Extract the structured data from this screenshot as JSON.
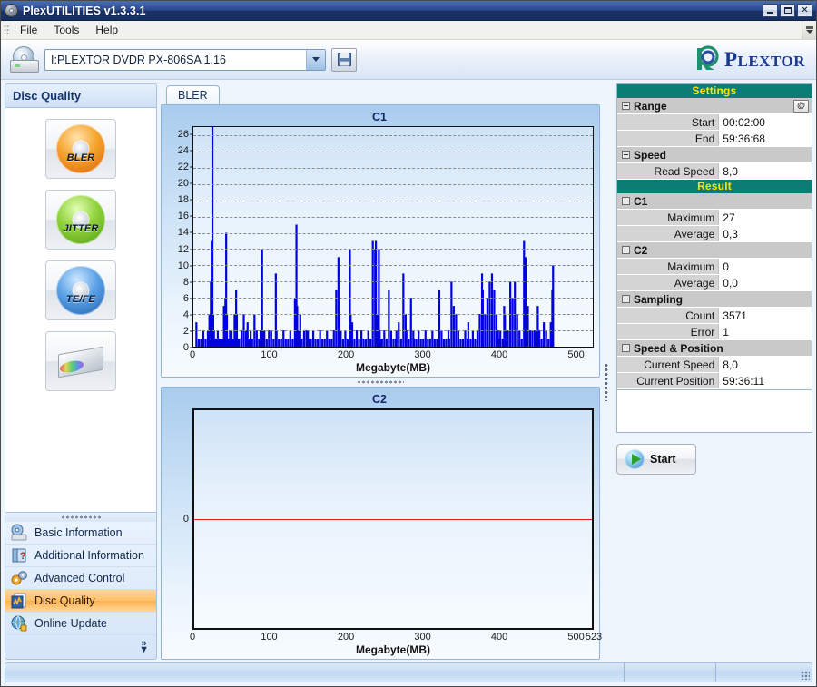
{
  "window": {
    "title": "PlexUTILITIES v1.3.3.1",
    "icon": "disc-icon",
    "minimize_label": "_",
    "maximize_label": "□",
    "close_label": "✕"
  },
  "menu": {
    "items": [
      "File",
      "Tools",
      "Help"
    ],
    "overflow_icon": "menu-overflow-icon"
  },
  "toolbar": {
    "drive_icon": "optical-drive-icon",
    "drive_value": "I:PLEXTOR DVDR  PX-806SA  1.16",
    "drive_placeholder": "Select drive",
    "dropdown_icon": "chevron-down-icon",
    "save_icon": "floppy-save-icon",
    "brand": "PLEXTOR",
    "brand_lead": "P",
    "brand_rest": "LEXTOR"
  },
  "sidebar": {
    "header": "Disc Quality",
    "task_buttons": [
      {
        "label": "BLER",
        "icon": "orange-disc-icon"
      },
      {
        "label": "JITTER",
        "icon": "green-disc-icon"
      },
      {
        "label": "TE/FE",
        "icon": "blue-disc-icon"
      },
      {
        "label": "",
        "icon": "drive-tray-icon"
      }
    ],
    "nav_items": [
      {
        "label": "Basic Information",
        "icon": "drive-info-icon",
        "active": false
      },
      {
        "label": "Additional Information",
        "icon": "book-question-icon",
        "active": false
      },
      {
        "label": "Advanced Control",
        "icon": "gears-icon",
        "active": false
      },
      {
        "label": "Disc Quality",
        "icon": "chart-page-icon",
        "active": true
      },
      {
        "label": "Online Update",
        "icon": "globe-update-icon",
        "active": false
      }
    ],
    "expand_icon": "chevrons-down-icon"
  },
  "tabs": [
    {
      "label": "BLER",
      "active": true
    }
  ],
  "chart_data": [
    {
      "type": "bar",
      "title": "C1",
      "xlabel": "Megabyte(MB)",
      "ylabel": "",
      "xticks": [
        0,
        100,
        200,
        300,
        400,
        500
      ],
      "yticks": [
        0,
        2,
        4,
        6,
        8,
        10,
        12,
        14,
        16,
        18,
        20,
        22,
        24,
        26
      ],
      "xlim": [
        0,
        523
      ],
      "ylim": [
        0,
        27
      ],
      "grid": true,
      "series_color": "#0000e0",
      "x": [
        4,
        7,
        10,
        13,
        16,
        19,
        21,
        22,
        23,
        24,
        25,
        26,
        27,
        28,
        30,
        32,
        34,
        36,
        38,
        40,
        42,
        43,
        44,
        46,
        48,
        50,
        52,
        54,
        56,
        57,
        58,
        60,
        63,
        66,
        69,
        71,
        73,
        75,
        77,
        80,
        83,
        86,
        88,
        90,
        91,
        93,
        96,
        99,
        102,
        105,
        108,
        109,
        112,
        115,
        118,
        121,
        124,
        127,
        130,
        133,
        135,
        136,
        138,
        140,
        142,
        145,
        148,
        150,
        151,
        154,
        157,
        160,
        163,
        166,
        169,
        172,
        175,
        178,
        181,
        184,
        187,
        190,
        191,
        193,
        196,
        199,
        202,
        205,
        206,
        208,
        211,
        214,
        217,
        220,
        223,
        226,
        229,
        232,
        235,
        238,
        239,
        241,
        243,
        244,
        245,
        247,
        250,
        253,
        256,
        259,
        262,
        265,
        266,
        269,
        272,
        275,
        278,
        279,
        282,
        285,
        288,
        289,
        292,
        295,
        298,
        301,
        304,
        307,
        310,
        313,
        316,
        319,
        322,
        325,
        328,
        331,
        334,
        335,
        338,
        341,
        344,
        347,
        350,
        353,
        356,
        359,
        360,
        363,
        366,
        369,
        372,
        375,
        378,
        379,
        382,
        385,
        388,
        391,
        394,
        397,
        399,
        400,
        402,
        405,
        407,
        408,
        409,
        410,
        412,
        415,
        418,
        421,
        424,
        427,
        430,
        433,
        435,
        438,
        441,
        444,
        447,
        450,
        451,
        453,
        456,
        459,
        462,
        465,
        468,
        470,
        471,
        473,
        476,
        479,
        482,
        485,
        488,
        490,
        493,
        496,
        499,
        502,
        505,
        508,
        511,
        514,
        516,
        518,
        520
      ],
      "y": [
        3,
        1,
        1,
        2,
        1,
        2,
        4,
        1,
        8,
        13,
        27,
        4,
        2,
        1,
        1,
        2,
        1,
        1,
        1,
        5,
        6,
        14,
        4,
        1,
        2,
        2,
        1,
        4,
        7,
        4,
        1,
        1,
        2,
        4,
        2,
        3,
        1,
        2,
        1,
        4,
        2,
        1,
        2,
        12,
        2,
        2,
        1,
        2,
        2,
        1,
        9,
        2,
        1,
        1,
        2,
        1,
        1,
        2,
        1,
        6,
        15,
        5,
        2,
        4,
        1,
        2,
        2,
        2,
        1,
        1,
        2,
        1,
        1,
        2,
        1,
        1,
        2,
        1,
        1,
        2,
        7,
        11,
        4,
        2,
        1,
        2,
        1,
        12,
        4,
        3,
        1,
        2,
        1,
        2,
        1,
        1,
        2,
        1,
        13,
        12,
        13,
        4,
        12,
        2,
        1,
        1,
        2,
        1,
        7,
        2,
        1,
        1,
        2,
        3,
        1,
        9,
        4,
        2,
        1,
        6,
        2,
        1,
        1,
        2,
        1,
        1,
        2,
        1,
        1,
        2,
        1,
        1,
        7,
        2,
        1,
        1,
        2,
        1,
        8,
        5,
        4,
        2,
        1,
        1,
        2,
        1,
        3,
        1,
        2,
        1,
        2,
        4,
        9,
        7,
        4,
        6,
        8,
        9,
        7,
        4,
        2,
        1,
        2,
        1,
        5,
        4,
        2,
        1,
        2,
        8,
        6,
        8,
        4,
        2,
        1,
        13,
        11,
        5,
        2,
        2,
        2,
        2,
        5,
        2,
        1,
        3,
        2,
        1,
        3,
        7,
        10
      ]
    },
    {
      "type": "line",
      "title": "C2",
      "xlabel": "Megabyte(MB)",
      "ylabel": "",
      "xticks": [
        0,
        100,
        200,
        300,
        400,
        500
      ],
      "xtick_extra": "523",
      "yticks": [
        0
      ],
      "xlim": [
        0,
        523
      ],
      "ylim": [
        -1,
        1
      ],
      "grid": false,
      "series_color": "#e01b1b",
      "x": [
        0,
        523
      ],
      "y": [
        0,
        0
      ]
    }
  ],
  "settings": {
    "section_title": "Settings",
    "groups": [
      {
        "name": "Range",
        "button": "@",
        "rows": [
          {
            "key": "Start",
            "value": "00:02:00"
          },
          {
            "key": "End",
            "value": "59:36:68"
          }
        ]
      },
      {
        "name": "Speed",
        "rows": [
          {
            "key": "Read Speed",
            "value": "8,0"
          }
        ]
      }
    ]
  },
  "result": {
    "section_title": "Result",
    "groups": [
      {
        "name": "C1",
        "rows": [
          {
            "key": "Maximum",
            "value": "27"
          },
          {
            "key": "Average",
            "value": "0,3"
          }
        ]
      },
      {
        "name": "C2",
        "rows": [
          {
            "key": "Maximum",
            "value": "0"
          },
          {
            "key": "Average",
            "value": "0,0"
          }
        ]
      },
      {
        "name": "Sampling",
        "rows": [
          {
            "key": "Count",
            "value": "3571"
          },
          {
            "key": "Error",
            "value": "1"
          }
        ]
      },
      {
        "name": "Speed & Position",
        "rows": [
          {
            "key": "Current Speed",
            "value": "8,0"
          },
          {
            "key": "Current Position",
            "value": "59:36:11"
          }
        ]
      }
    ]
  },
  "actions": {
    "start_label": "Start",
    "start_icon": "play-icon"
  },
  "statusbar": {
    "cells": [
      "",
      "",
      ""
    ],
    "resize_grip": "resize-grip-icon"
  },
  "colors": {
    "titlebar": "#27478a",
    "section_header_bg": "#0b7d74",
    "section_header_fg": "#ffe600",
    "c1_series": "#0000e0",
    "c2_series": "#e01b1b",
    "nav_active": "#ffc06a",
    "brand": "#1b3a8f"
  }
}
